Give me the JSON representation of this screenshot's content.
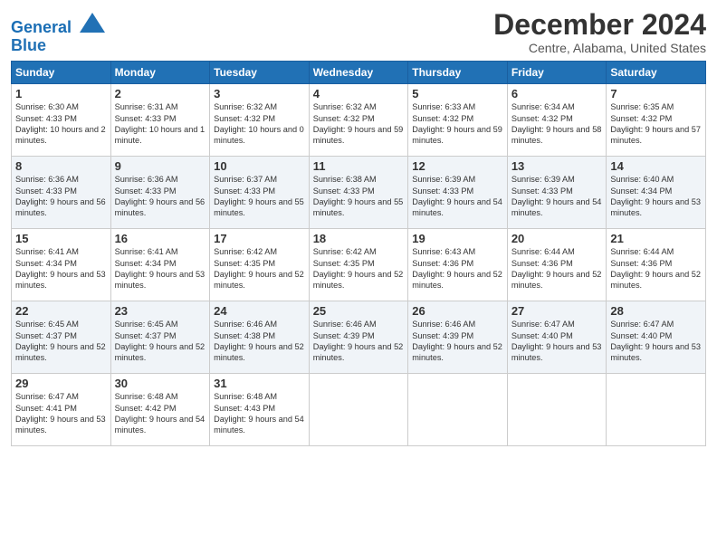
{
  "header": {
    "logo_line1": "General",
    "logo_line2": "Blue",
    "month": "December 2024",
    "location": "Centre, Alabama, United States"
  },
  "days_of_week": [
    "Sunday",
    "Monday",
    "Tuesday",
    "Wednesday",
    "Thursday",
    "Friday",
    "Saturday"
  ],
  "weeks": [
    [
      {
        "day": "1",
        "sunrise": "6:30 AM",
        "sunset": "4:33 PM",
        "daylight": "10 hours and 2 minutes."
      },
      {
        "day": "2",
        "sunrise": "6:31 AM",
        "sunset": "4:33 PM",
        "daylight": "10 hours and 1 minute."
      },
      {
        "day": "3",
        "sunrise": "6:32 AM",
        "sunset": "4:32 PM",
        "daylight": "10 hours and 0 minutes."
      },
      {
        "day": "4",
        "sunrise": "6:32 AM",
        "sunset": "4:32 PM",
        "daylight": "9 hours and 59 minutes."
      },
      {
        "day": "5",
        "sunrise": "6:33 AM",
        "sunset": "4:32 PM",
        "daylight": "9 hours and 59 minutes."
      },
      {
        "day": "6",
        "sunrise": "6:34 AM",
        "sunset": "4:32 PM",
        "daylight": "9 hours and 58 minutes."
      },
      {
        "day": "7",
        "sunrise": "6:35 AM",
        "sunset": "4:32 PM",
        "daylight": "9 hours and 57 minutes."
      }
    ],
    [
      {
        "day": "8",
        "sunrise": "6:36 AM",
        "sunset": "4:33 PM",
        "daylight": "9 hours and 56 minutes."
      },
      {
        "day": "9",
        "sunrise": "6:36 AM",
        "sunset": "4:33 PM",
        "daylight": "9 hours and 56 minutes."
      },
      {
        "day": "10",
        "sunrise": "6:37 AM",
        "sunset": "4:33 PM",
        "daylight": "9 hours and 55 minutes."
      },
      {
        "day": "11",
        "sunrise": "6:38 AM",
        "sunset": "4:33 PM",
        "daylight": "9 hours and 55 minutes."
      },
      {
        "day": "12",
        "sunrise": "6:39 AM",
        "sunset": "4:33 PM",
        "daylight": "9 hours and 54 minutes."
      },
      {
        "day": "13",
        "sunrise": "6:39 AM",
        "sunset": "4:33 PM",
        "daylight": "9 hours and 54 minutes."
      },
      {
        "day": "14",
        "sunrise": "6:40 AM",
        "sunset": "4:34 PM",
        "daylight": "9 hours and 53 minutes."
      }
    ],
    [
      {
        "day": "15",
        "sunrise": "6:41 AM",
        "sunset": "4:34 PM",
        "daylight": "9 hours and 53 minutes."
      },
      {
        "day": "16",
        "sunrise": "6:41 AM",
        "sunset": "4:34 PM",
        "daylight": "9 hours and 53 minutes."
      },
      {
        "day": "17",
        "sunrise": "6:42 AM",
        "sunset": "4:35 PM",
        "daylight": "9 hours and 52 minutes."
      },
      {
        "day": "18",
        "sunrise": "6:42 AM",
        "sunset": "4:35 PM",
        "daylight": "9 hours and 52 minutes."
      },
      {
        "day": "19",
        "sunrise": "6:43 AM",
        "sunset": "4:36 PM",
        "daylight": "9 hours and 52 minutes."
      },
      {
        "day": "20",
        "sunrise": "6:44 AM",
        "sunset": "4:36 PM",
        "daylight": "9 hours and 52 minutes."
      },
      {
        "day": "21",
        "sunrise": "6:44 AM",
        "sunset": "4:36 PM",
        "daylight": "9 hours and 52 minutes."
      }
    ],
    [
      {
        "day": "22",
        "sunrise": "6:45 AM",
        "sunset": "4:37 PM",
        "daylight": "9 hours and 52 minutes."
      },
      {
        "day": "23",
        "sunrise": "6:45 AM",
        "sunset": "4:37 PM",
        "daylight": "9 hours and 52 minutes."
      },
      {
        "day": "24",
        "sunrise": "6:46 AM",
        "sunset": "4:38 PM",
        "daylight": "9 hours and 52 minutes."
      },
      {
        "day": "25",
        "sunrise": "6:46 AM",
        "sunset": "4:39 PM",
        "daylight": "9 hours and 52 minutes."
      },
      {
        "day": "26",
        "sunrise": "6:46 AM",
        "sunset": "4:39 PM",
        "daylight": "9 hours and 52 minutes."
      },
      {
        "day": "27",
        "sunrise": "6:47 AM",
        "sunset": "4:40 PM",
        "daylight": "9 hours and 53 minutes."
      },
      {
        "day": "28",
        "sunrise": "6:47 AM",
        "sunset": "4:40 PM",
        "daylight": "9 hours and 53 minutes."
      }
    ],
    [
      {
        "day": "29",
        "sunrise": "6:47 AM",
        "sunset": "4:41 PM",
        "daylight": "9 hours and 53 minutes."
      },
      {
        "day": "30",
        "sunrise": "6:48 AM",
        "sunset": "4:42 PM",
        "daylight": "9 hours and 54 minutes."
      },
      {
        "day": "31",
        "sunrise": "6:48 AM",
        "sunset": "4:43 PM",
        "daylight": "9 hours and 54 minutes."
      },
      null,
      null,
      null,
      null
    ]
  ]
}
